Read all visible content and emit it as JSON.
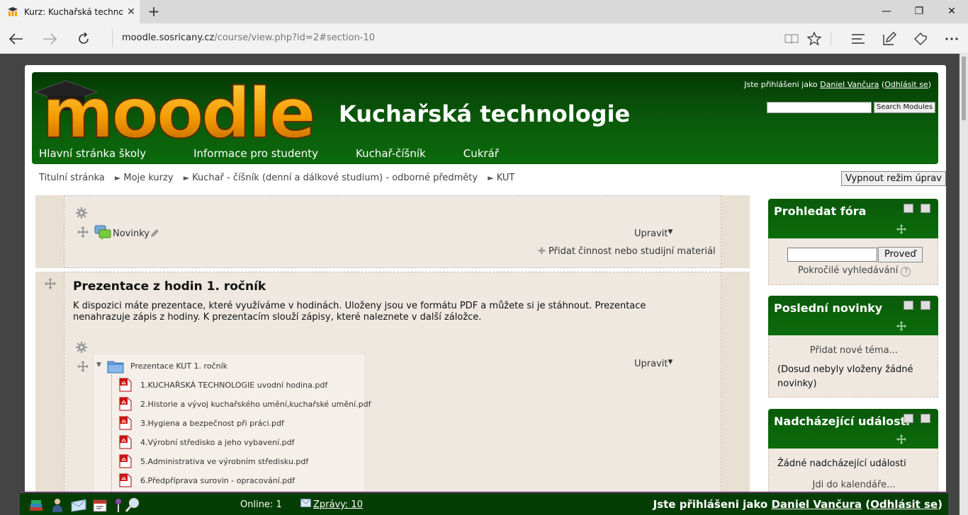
{
  "browser": {
    "tab_title": "Kurz: Kuchařská technol",
    "url_host": "moodle.sosricany.cz",
    "url_path": "/course/view.php?id=2#section-10"
  },
  "header": {
    "logo_text": "moodle",
    "course_title": "Kuchařská technologie",
    "login_prefix": "Jste přihlášeni jako ",
    "user_name": "Daniel Vančura",
    "logout": "Odhlásit se",
    "search_button": "Search Modules",
    "nav": [
      "Hlavní stránka školy",
      "Informace pro studenty",
      "Kuchař-číšník",
      "Cukrář"
    ]
  },
  "breadcrumb": [
    "Titulní stránka",
    "Moje kurzy",
    "Kuchař - číšník (denní a dálkové studium) - odborné předměty",
    "KUT"
  ],
  "edit_mode_button": "Vypnout režim úprav",
  "section0": {
    "forum_name": "Novinky",
    "edit_label": "Upravit",
    "add_activity": "Přidat činnost nebo studijní materiál"
  },
  "section1": {
    "heading": "Prezentace z hodin 1. ročník",
    "summary": "K dispozici máte prezentace, které využíváme v hodinách. Uloženy jsou ve formátu PDF a můžete si je stáhnout. Prezentace nenahrazuje zápis z hodiny. K prezentacím slouží zápisy, které naleznete v další záložce.",
    "edit_label": "Upravit",
    "folder_name": "Prezentace KUT 1. ročník",
    "files": [
      "1.KUCHAŘSKÁ TECHNOLOGIE uvodní hodina.pdf",
      "2.Historie a vývoj kuchařského umění,kuchařské umění.pdf",
      "3.Hygiena a bezpečnost při práci.pdf",
      "4.Výrobní středisko a jeho vybavení.pdf",
      "5.Administrativa ve výrobním středisku.pdf",
      "6.Předpříprava surovin - opracování.pdf"
    ]
  },
  "blocks": {
    "search_forums": {
      "title": "Prohledat fóra",
      "button": "Proveď",
      "advanced": "Pokročilé vyhledávání"
    },
    "news": {
      "title": "Poslední novinky",
      "add_topic": "Přidat nové téma...",
      "empty": "(Dosud nebyly vloženy žádné novinky)"
    },
    "events": {
      "title": "Nadcházející události",
      "empty": "Žádné nadcházející události",
      "calendar": "Jdi do kalendáře..."
    }
  },
  "dock": {
    "online": "Online: 1",
    "messages": "Zprávy: 10",
    "login_prefix": "Jste přihlášeni jako ",
    "user_name": "Daniel Vančura",
    "logout": "Odhlásit se"
  },
  "colors": {
    "header_green": "#0a5b0a",
    "section_bg": "#eee8e0"
  }
}
